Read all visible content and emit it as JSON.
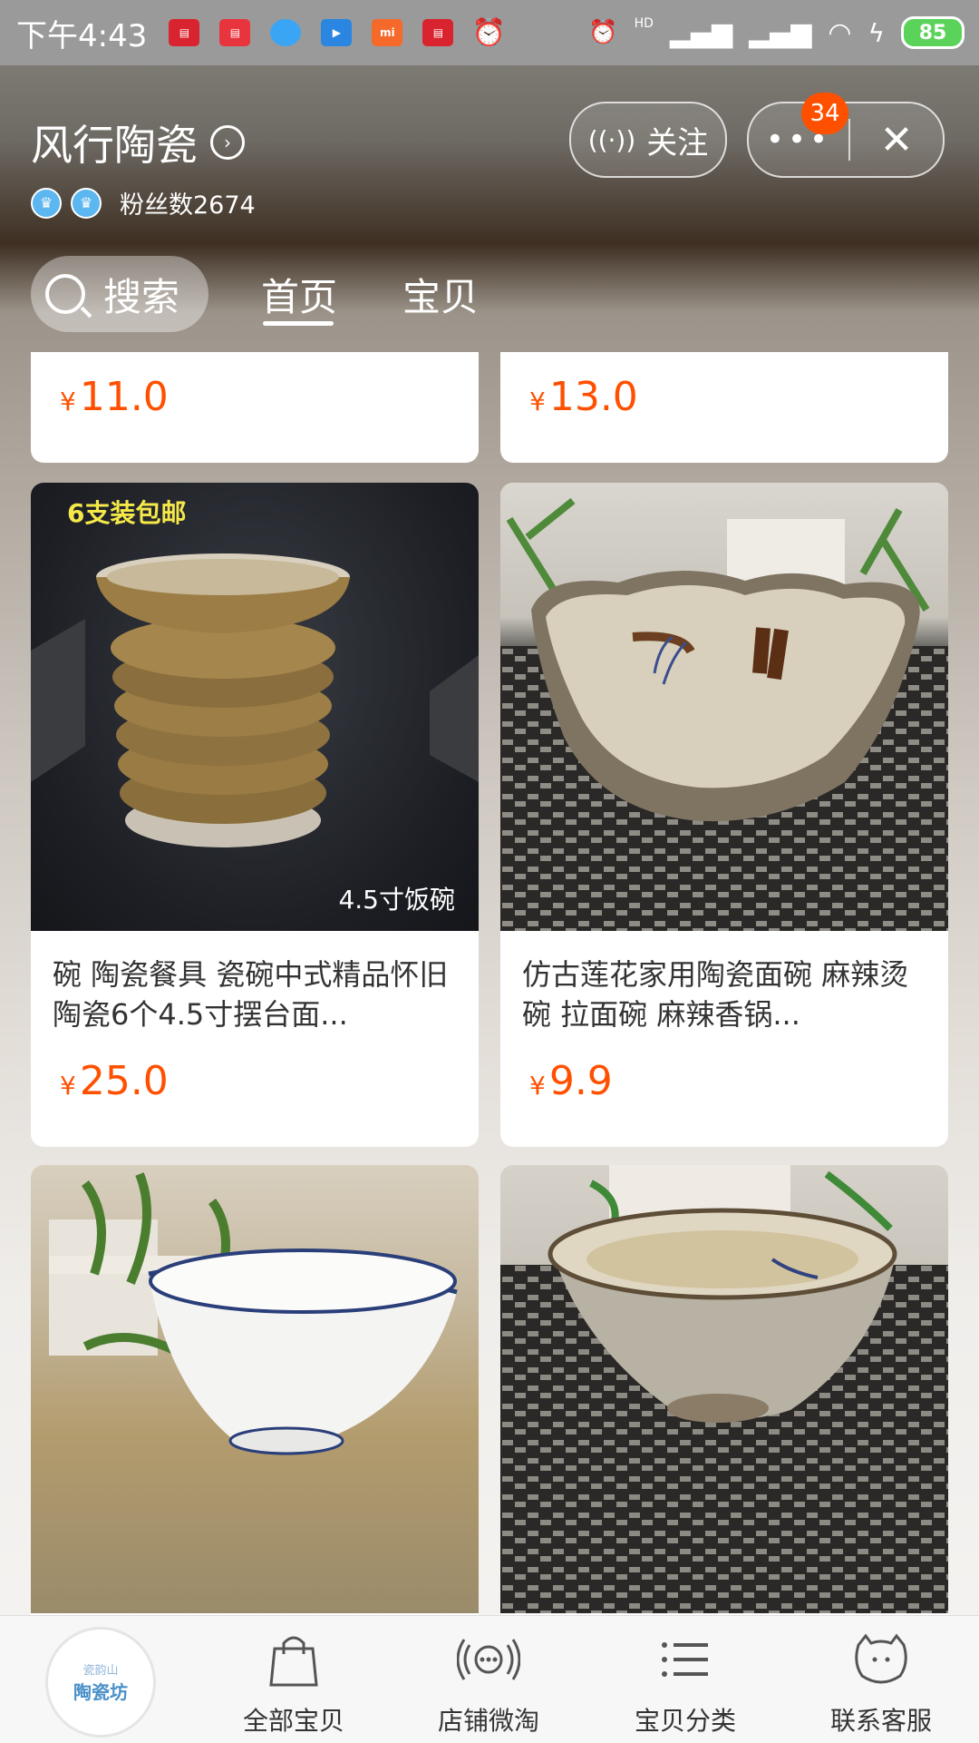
{
  "status_bar": {
    "time": "下午4:43",
    "notifications": [
      "news-icon",
      "toutiao-icon",
      "blue-app-icon",
      "video-app-icon",
      "mi-icon",
      "news-icon",
      "alarm-robot-icon"
    ],
    "hd_label": "HD",
    "battery": "85"
  },
  "store": {
    "name": "风行陶瓷",
    "fans_label": "粉丝数2674",
    "follow_label": "关注",
    "more_badge": "34"
  },
  "tabs": {
    "search": "搜索",
    "home": "首页",
    "items": "宝贝"
  },
  "products": [
    {
      "title": "",
      "price": "11.0"
    },
    {
      "title": "",
      "price": "13.0"
    },
    {
      "title": "碗 陶瓷餐具 瓷碗中式精品怀旧陶瓷6个4.5寸摆台面...",
      "price": "25.0",
      "overlay_top": "6支装包邮",
      "overlay_bottom": "4.5寸饭碗"
    },
    {
      "title": "仿古莲花家用陶瓷面碗 麻辣烫碗 拉面碗 麻辣香锅...",
      "price": "9.9"
    },
    {
      "title": "",
      "price": ""
    },
    {
      "title": "",
      "price": ""
    }
  ],
  "currency": "¥",
  "bottom_nav": {
    "logo_line1": "瓷韵山",
    "logo_line2": "陶瓷坊",
    "all_items": "全部宝贝",
    "weitao": "店铺微淘",
    "category": "宝贝分类",
    "service": "联系客服"
  },
  "colors": {
    "accent": "#ff5000",
    "overlay_yellow": "#f5e94a"
  }
}
